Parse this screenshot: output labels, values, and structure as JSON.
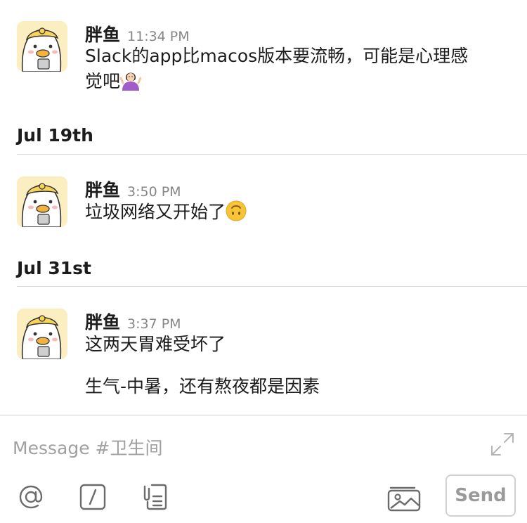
{
  "messages": [
    {
      "author": "胖鱼",
      "time": "11:34 PM",
      "text_a": "Slack的app比macos版本要流畅，可能是心理感",
      "text_b": "觉吧",
      "emoji": "person-shrugging-emoji"
    },
    {
      "author": "胖鱼",
      "time": "3:50 PM",
      "text": "垃圾网络又开始了",
      "emoji": "upside-down-face-emoji"
    },
    {
      "author": "胖鱼",
      "time": "3:37 PM",
      "text": "这两天胃难受坏了",
      "followup": "生气-中暑，还有熬夜都是因素"
    }
  ],
  "days": [
    "Jul 19th",
    "Jul 31st"
  ],
  "composer": {
    "placeholder": "Message #卫生间",
    "value": "",
    "send_label": "Send",
    "icons": [
      "at-icon",
      "slash-command-icon",
      "clipboard-icon",
      "photo-icon",
      "expand-icon"
    ]
  },
  "colors": {
    "text": "#1d1c1d",
    "timestamp": "#868686",
    "divider": "#d9d9d9",
    "placeholder": "#a0a0a0",
    "avatar_bg": "#fbeec0"
  }
}
